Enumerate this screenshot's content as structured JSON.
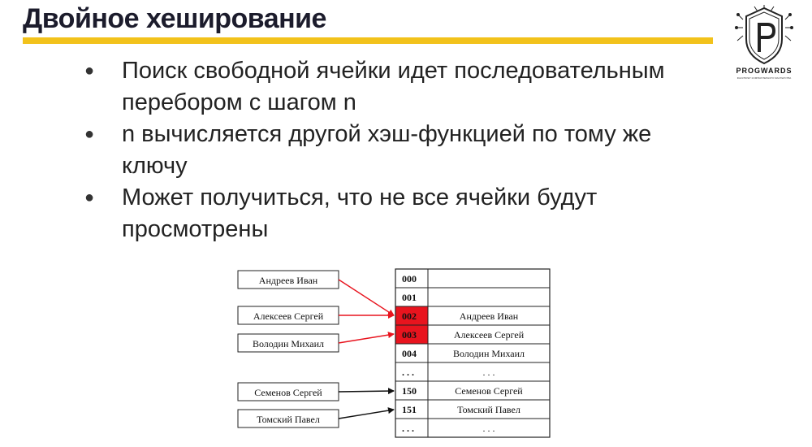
{
  "slide": {
    "title": "Двойное хеширование",
    "bullets": [
      "Поиск свободной ячейки идет последовательным перебором с шагом n",
      "n вычисляется другой хэш-функцией по тому же ключу",
      "Может получиться, что не все ячейки будут просмотрены"
    ]
  },
  "logo": {
    "text": "PROGWARDS",
    "subtext": "ФАКУЛЬТЕТ КОМПЬЮТЕРНОГО МАСТЕРСТВА",
    "icon": "shield-p-logo"
  },
  "diagram": {
    "keys": [
      "Андреев Иван",
      "Алексеев Сергей",
      "Володин Михаил",
      "Семенов Сергей",
      "Томский Павел"
    ],
    "table_rows": [
      {
        "index": "000",
        "value": "",
        "collision": false
      },
      {
        "index": "001",
        "value": "",
        "collision": false
      },
      {
        "index": "002",
        "value": "Андреев Иван",
        "collision": true
      },
      {
        "index": "003",
        "value": "Алексеев Сергей",
        "collision": true
      },
      {
        "index": "004",
        "value": "Володин Михаил",
        "collision": false
      },
      {
        "index": ". . .",
        "value": ". . .",
        "collision": false
      },
      {
        "index": "150",
        "value": "Семенов Сергей",
        "collision": false
      },
      {
        "index": "151",
        "value": "Томский Павел",
        "collision": false
      },
      {
        "index": ". . .",
        "value": ". . .",
        "collision": false
      }
    ],
    "colors": {
      "collision": "#e8141e",
      "accent": "#f2c21b",
      "arrow_red": "#e8141e",
      "arrow_black": "#111111"
    }
  }
}
